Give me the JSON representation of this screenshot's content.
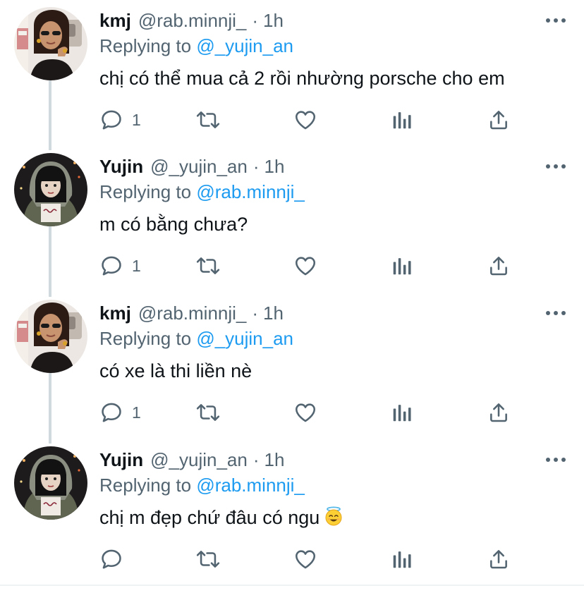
{
  "thread": {
    "tweets": [
      {
        "name": "kmj",
        "handle": "@rab.minnji_",
        "separator": "·",
        "time": "1h",
        "replying_prefix": "Replying to",
        "replying_to": "@_yujin_an",
        "text": "chị có thể mua cả 2 rồi nhường porsche cho em",
        "reply_count": "1",
        "avatar_icon": "avatar-kmj"
      },
      {
        "name": "Yujin",
        "handle": "@_yujin_an",
        "separator": "·",
        "time": "1h",
        "replying_prefix": "Replying to",
        "replying_to": "@rab.minnji_",
        "text": "m có bằng chưa?",
        "reply_count": "1",
        "avatar_icon": "avatar-yujin"
      },
      {
        "name": "kmj",
        "handle": "@rab.minnji_",
        "separator": "·",
        "time": "1h",
        "replying_prefix": "Replying to",
        "replying_to": "@_yujin_an",
        "text": "có xe là thi liền nè",
        "reply_count": "1",
        "avatar_icon": "avatar-kmj"
      },
      {
        "name": "Yujin",
        "handle": "@_yujin_an",
        "separator": "·",
        "time": "1h",
        "replying_prefix": "Replying to",
        "replying_to": "@rab.minnji_",
        "text": "chị m đẹp chứ đâu có ngu",
        "emoji": "smiling-face-with-halo",
        "reply_count": "",
        "avatar_icon": "avatar-yujin"
      }
    ]
  },
  "icons": {
    "reply": "reply-icon",
    "retweet": "retweet-icon",
    "like": "like-icon",
    "analytics": "analytics-icon",
    "share": "share-icon",
    "more": "more-icon"
  },
  "colors": {
    "link": "#1d9bf0",
    "secondary_text": "#536471",
    "primary_text": "#0f1419",
    "thread_line": "#cfd9de"
  }
}
